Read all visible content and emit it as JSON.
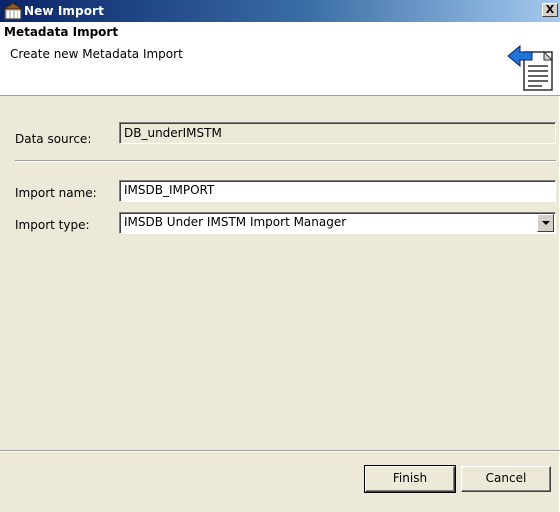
{
  "window": {
    "title": "New Import",
    "close_label": "X"
  },
  "banner": {
    "title": "Metadata Import",
    "subtitle": "Create new Metadata Import",
    "icon": "wizard-document-icon"
  },
  "form": {
    "data_source_label": "Data source:",
    "data_source_value": "DB_underIMSTM",
    "import_name_label": "Import name:",
    "import_name_value": "IMSDB_IMPORT",
    "import_type_label": "Import type:",
    "import_type_value": "IMSDB Under IMSTM Import Manager"
  },
  "buttons": {
    "finish": "Finish",
    "cancel": "Cancel"
  }
}
